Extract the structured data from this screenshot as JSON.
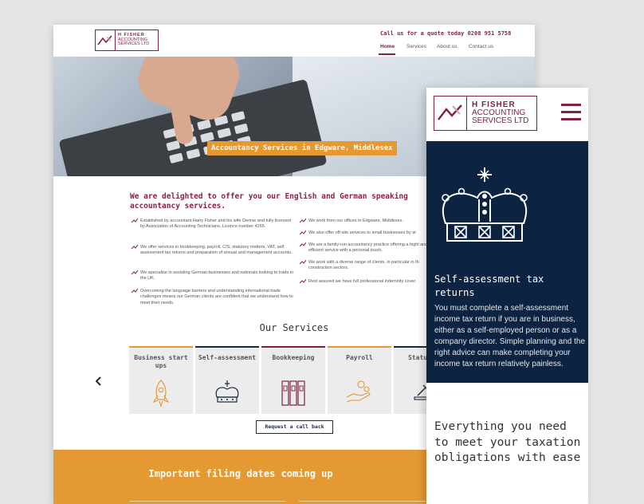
{
  "brand": {
    "line1": "H FISHER",
    "line2": "ACCOUNTING",
    "line3": "SERVICES LTD"
  },
  "header": {
    "phone": "Call us for a quote today 0208 951 5758",
    "nav": [
      "Home",
      "Services",
      "About us",
      "Contact us"
    ]
  },
  "hero": {
    "label": "Accountancy Services in Edgware, Middlesex"
  },
  "intro": {
    "heading": "We are delighted to offer you our English and German speaking accountancy services.",
    "left": [
      "Established by accountant Harry Fisher and his wife Denise and fully licensed by Association of Accounting Technicians, Licence number 4265.",
      "We offer services in bookkeeping, payroll, CIS, statutory matters, VAT, self assessment tax returns and preparation of annual and management accounts.",
      "We specialise in assisting German businesses and nationals looking to trade in the UK.",
      "Overcoming the language barriers and understanding international trade challenges means our German clients are confident that we understand how to meet their needs."
    ],
    "right": [
      "We work from our offices in Edgware, Middlesex.",
      "We also offer off-site services to small businesses by ar",
      "We are a family-run accountancy practice offering a highl and efficient service with a personal touch.",
      "We work with a diverse range of clients, in particular in th construction sectors.",
      "Rest assured we have full professional indemnity cover."
    ]
  },
  "services": {
    "heading": "Our Services",
    "cards": [
      "Business start ups",
      "Self-assessment",
      "Bookkeeping",
      "Payroll",
      "Statu serv"
    ],
    "prev_icon": "chevron-left-icon",
    "cta": "Request a call back"
  },
  "filing": {
    "heading": "Important filing dates coming up"
  },
  "mobile": {
    "menu_icon": "hamburger-icon",
    "card_icon": "crown-icon",
    "card_title": "Self-assessment tax returns",
    "card_body": "You must complete a self-assessment income tax return if you are in business, either as a self-employed person or as a company director. Simple planning and the right advice can make completing your income tax return relatively painless.",
    "tagline": "Everything you need to meet your taxation obligations with ease"
  },
  "colors": {
    "brand": "#7d2244",
    "accent": "#e49932",
    "navy": "#0c2441"
  }
}
